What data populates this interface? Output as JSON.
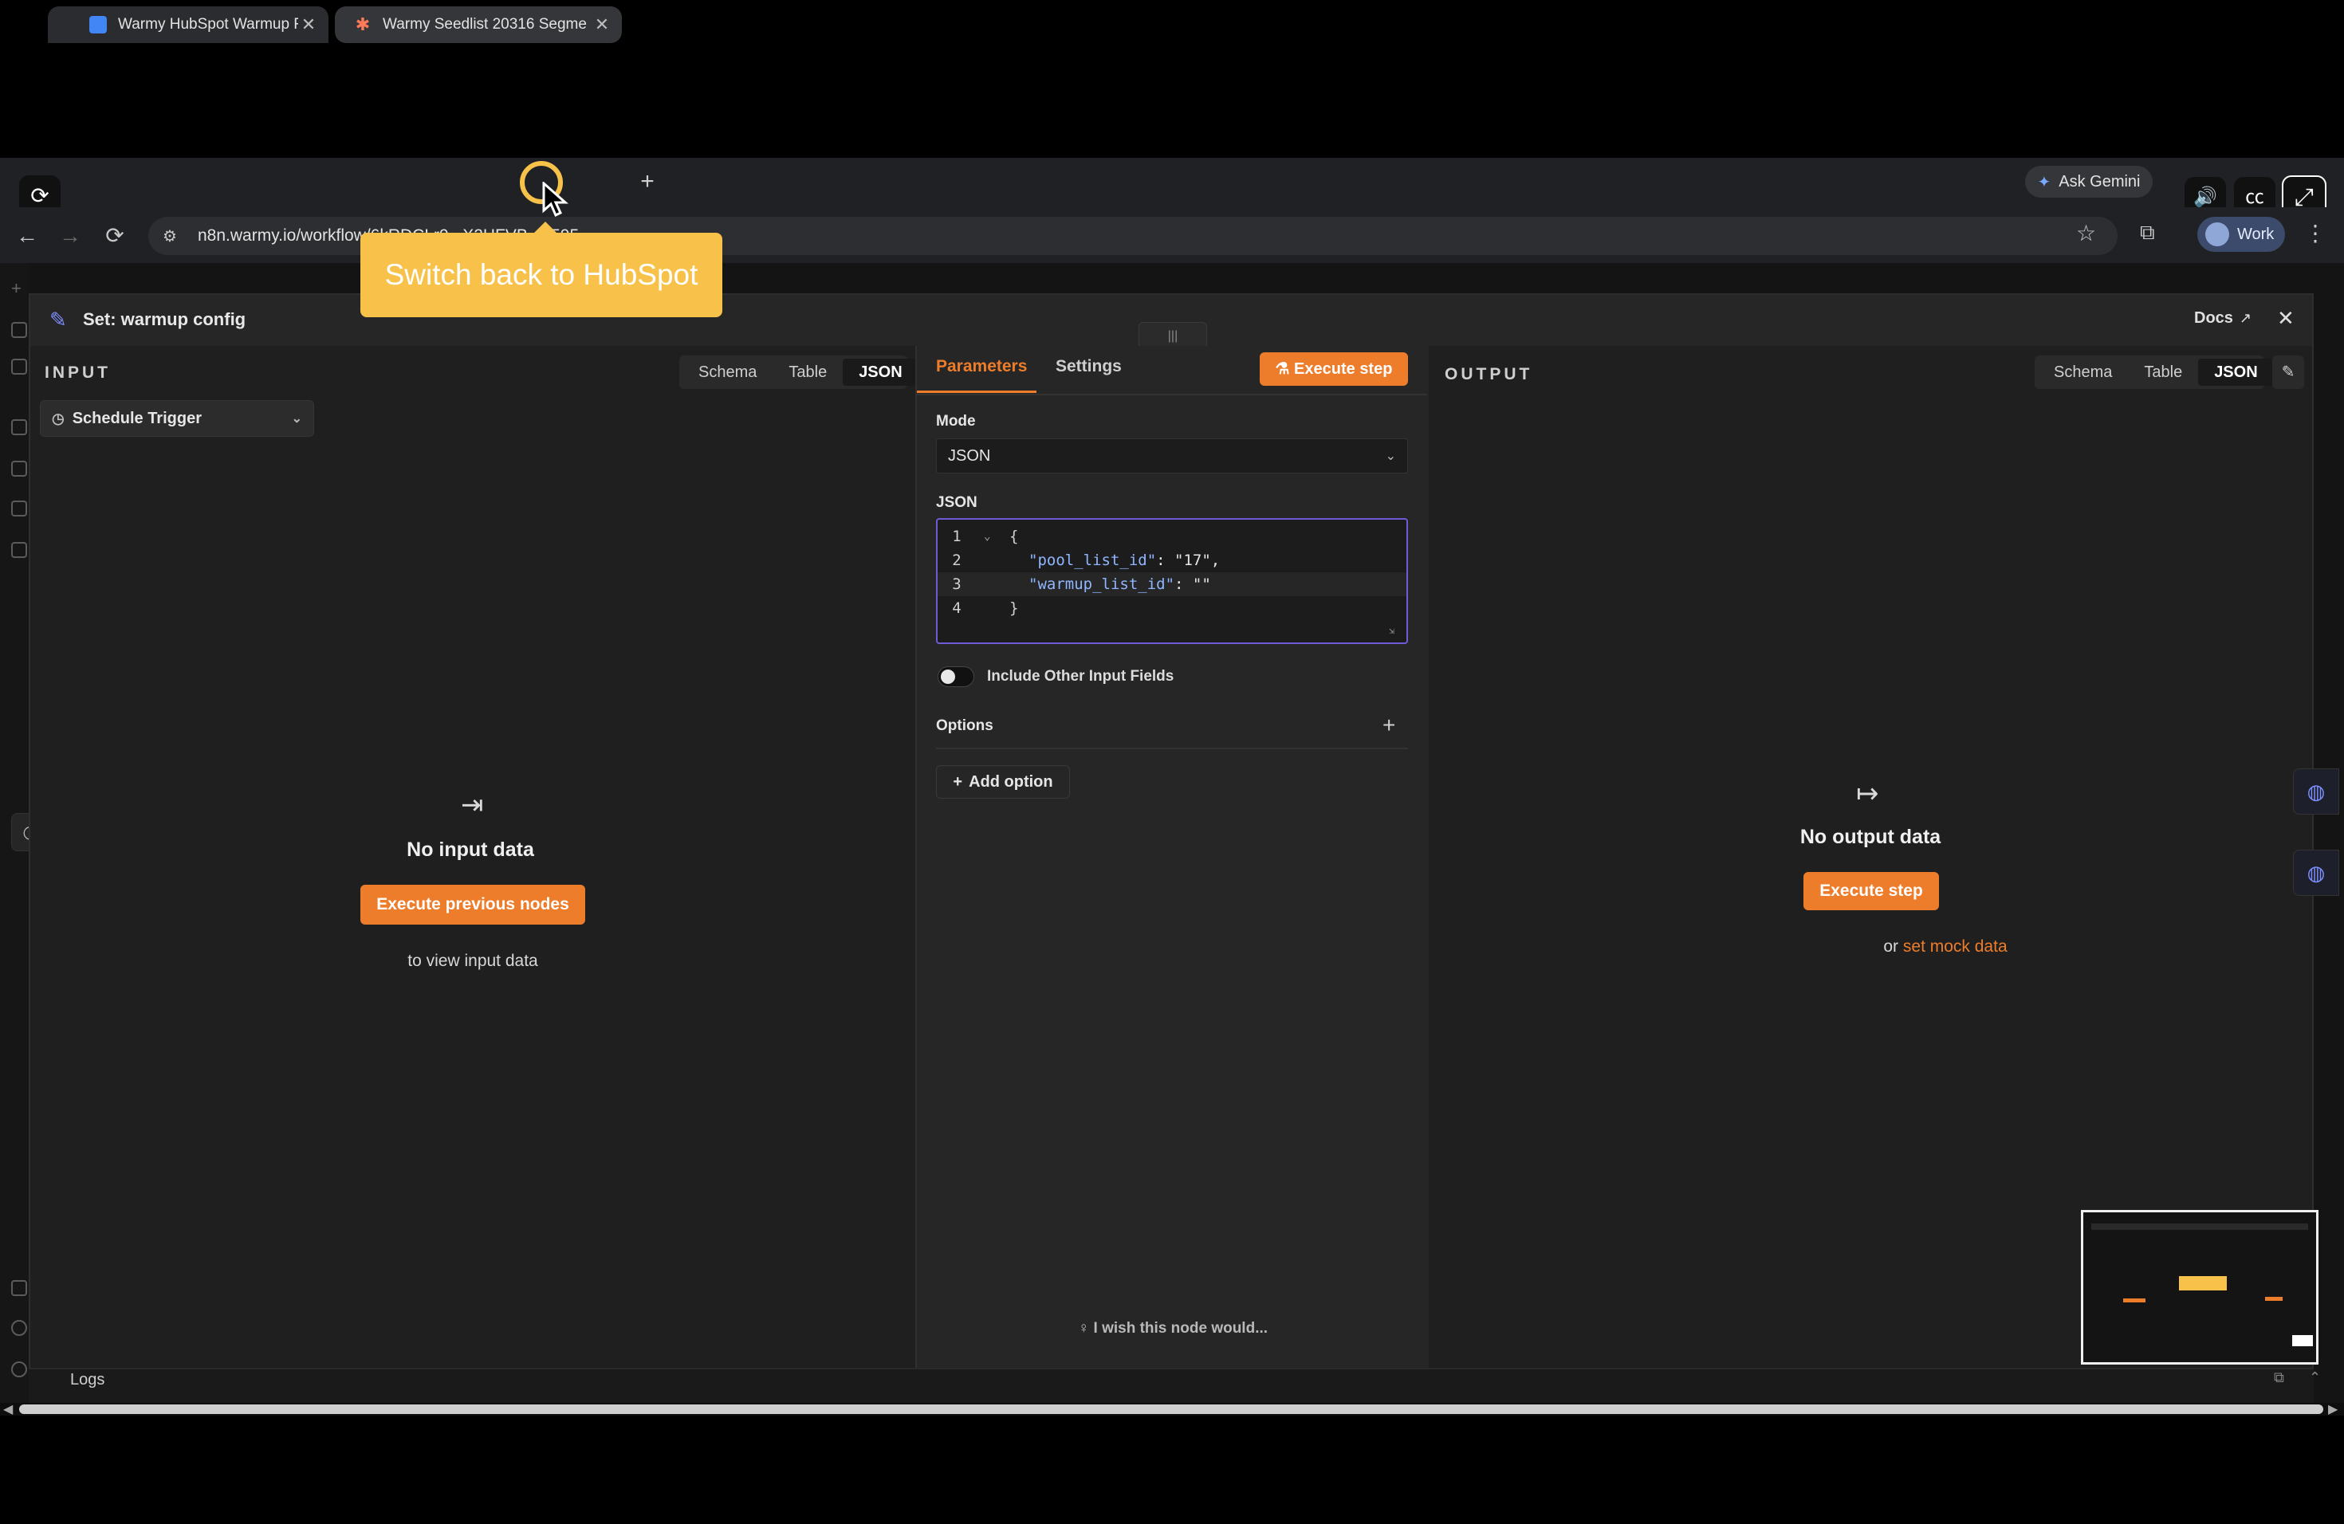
{
  "browser": {
    "tabs": [
      {
        "title": "Warmy HubSpot Warmup F",
        "active": false
      },
      {
        "title": "Warmy Seedlist 20316 Segme",
        "active": true
      }
    ],
    "new_tab": "+",
    "ask_gemini": "Ask Gemini",
    "url": "n8n.warmy.io/workflow/6kRDCLr9...X2HFVB...9595",
    "profile": "Work"
  },
  "tooltip": {
    "text": "Switch back to HubSpot"
  },
  "node": {
    "title": "Set: warmup config",
    "docs": "Docs"
  },
  "input": {
    "label": "INPUT",
    "views": [
      "Schema",
      "Table",
      "JSON"
    ],
    "active_view": "JSON",
    "trigger": "Schedule Trigger",
    "empty_title": "No input data",
    "button": "Execute previous nodes",
    "subtext": "to view input data"
  },
  "params": {
    "tabs": [
      "Parameters",
      "Settings"
    ],
    "execute": "Execute step",
    "mode_label": "Mode",
    "mode_value": "JSON",
    "json_label": "JSON",
    "json_lines": [
      {
        "n": "1",
        "text": "{"
      },
      {
        "n": "2",
        "key": "\"pool_list_id\"",
        "rest": ": \"17\","
      },
      {
        "n": "3",
        "key": "\"warmup_list_id\"",
        "rest": ": \"\""
      },
      {
        "n": "4",
        "text": "}"
      }
    ],
    "include_other": "Include Other Input Fields",
    "options_label": "Options",
    "add_option": "Add option",
    "wish": "I wish this node would..."
  },
  "output": {
    "label": "OUTPUT",
    "views": [
      "Schema",
      "Table",
      "JSON"
    ],
    "active_view": "JSON",
    "empty_title": "No output data",
    "button": "Execute step",
    "or": "or",
    "mock_link": "set mock data"
  },
  "logs": {
    "label": "Logs"
  },
  "colors": {
    "accent": "#ee7d2b",
    "focus": "#6e5bd6",
    "tooltip": "#f8c24a"
  }
}
